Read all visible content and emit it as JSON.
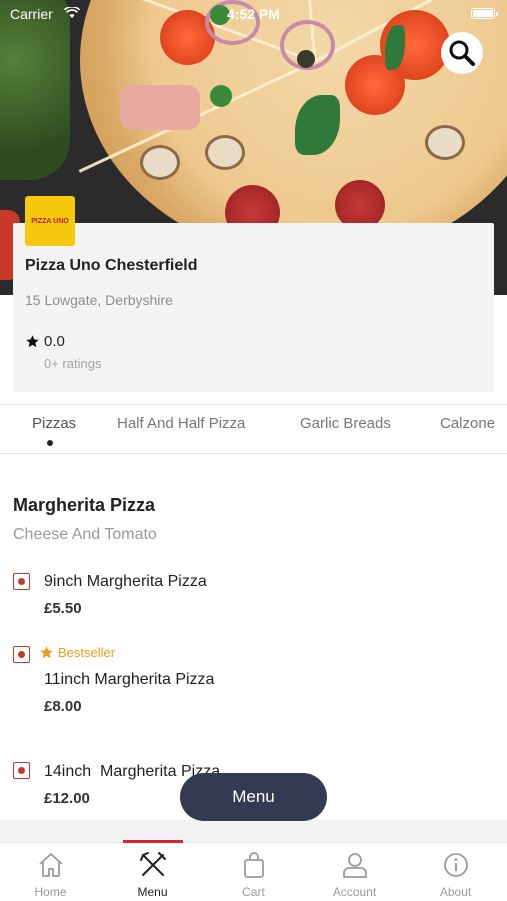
{
  "status_bar": {
    "carrier": "Carrier",
    "time": "4:52 PM"
  },
  "restaurant": {
    "logo_text": "PIZZA UNO",
    "name": "Pizza Uno Chesterfield",
    "address": "15 Lowgate, Derbyshire",
    "rating": "0.0",
    "rating_count": "0+ ratings"
  },
  "categories": [
    {
      "label": "Pizzas",
      "active": true
    },
    {
      "label": "Half And Half Pizza",
      "active": false
    },
    {
      "label": "Garlic Breads",
      "active": false
    },
    {
      "label": "Calzone",
      "active": false
    }
  ],
  "section": {
    "title": "Margherita Pizza",
    "subtitle": "Cheese And Tomato"
  },
  "items": [
    {
      "name": "9inch Margherita Pizza",
      "price": "£5.50",
      "badge": ""
    },
    {
      "name": "11inch Margherita Pizza",
      "price": "£8.00",
      "badge": "Bestseller"
    },
    {
      "name": "14inch  Margherita Pizza",
      "price": "£12.00",
      "badge": ""
    }
  ],
  "menu_button_label": "Menu",
  "bottom_nav": [
    {
      "label": "Home",
      "icon": "home-icon",
      "active": false
    },
    {
      "label": "Menu",
      "icon": "fork-knife-icon",
      "active": true
    },
    {
      "label": "Cart",
      "icon": "shopping-bag-icon",
      "active": false
    },
    {
      "label": "Account",
      "icon": "user-icon",
      "active": false
    },
    {
      "label": "About",
      "icon": "info-icon",
      "active": false
    }
  ],
  "colors": {
    "accent_red": "#d9262c",
    "bestseller_orange": "#f29a1c",
    "menu_button_bg": "#343a52",
    "logo_yellow": "#f6c90e"
  }
}
